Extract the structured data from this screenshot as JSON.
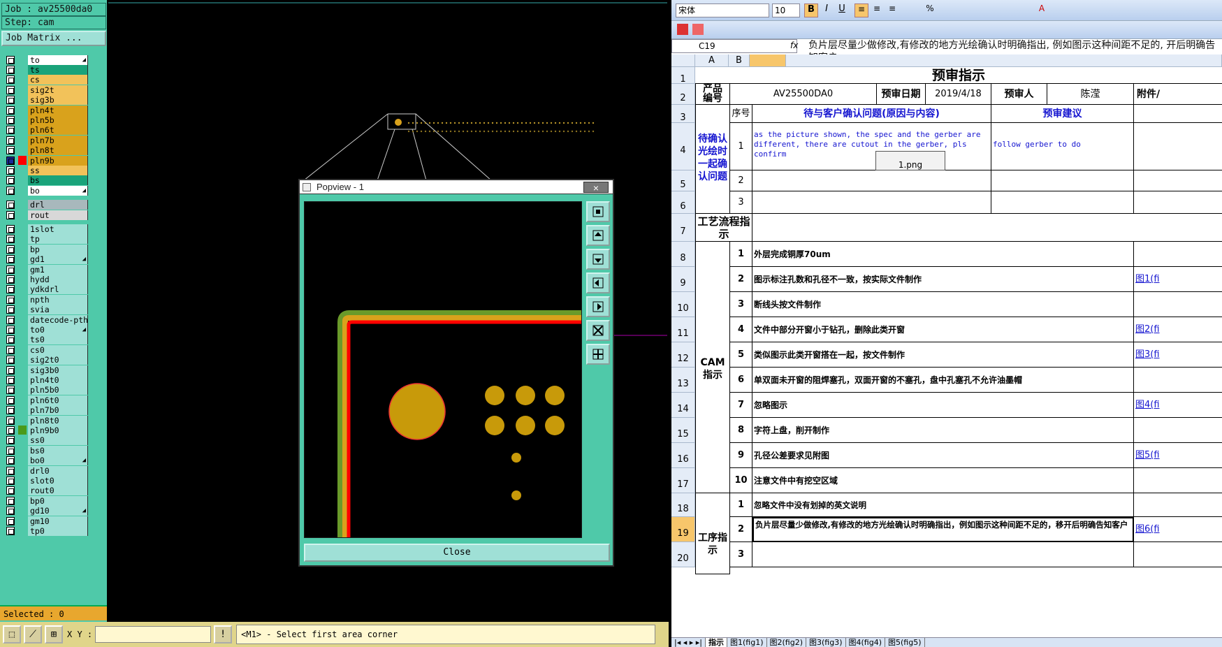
{
  "cam": {
    "job": "Job : av25500da0",
    "step": "Step: cam",
    "job_matrix": "Job Matrix ...",
    "selected": "Selected : 0",
    "xy_label": "X Y :",
    "message": "<M1> - Select first area corner"
  },
  "layers": [
    {
      "name": "to",
      "color": "#ffffff",
      "arrow": true
    },
    {
      "name": "ts",
      "color": "#1aa37a"
    },
    {
      "name": "cs",
      "color": "#f2c25a"
    },
    {
      "name": "sig2t",
      "color": "#f2c25a"
    },
    {
      "name": "sig3b",
      "color": "#f2c25a"
    },
    {
      "name": "pln4t",
      "color": "#d9a21c"
    },
    {
      "name": "pln5b",
      "color": "#d9a21c"
    },
    {
      "name": "pln6t",
      "color": "#d9a21c"
    },
    {
      "name": "pln7b",
      "color": "#d9a21c"
    },
    {
      "name": "pln8t",
      "color": "#d9a21c"
    },
    {
      "name": "pln9b",
      "color": "#d9a21c",
      "active": true
    },
    {
      "name": "ss",
      "color": "#f2c25a"
    },
    {
      "name": "bs",
      "color": "#1aa37a"
    },
    {
      "name": "bo",
      "color": "#ffffff",
      "arrow": true
    },
    {
      "name": "drl",
      "color": "#a8b8bc"
    },
    {
      "name": "rout",
      "color": "#d8d8d8"
    },
    {
      "name": "1slot",
      "color": "#9fe0d6"
    },
    {
      "name": "tp",
      "color": "#9fe0d6"
    },
    {
      "name": "bp",
      "color": "#9fe0d6"
    },
    {
      "name": "gd1",
      "color": "#9fe0d6",
      "arrow": true
    },
    {
      "name": "gm1",
      "color": "#9fe0d6"
    },
    {
      "name": "hydd",
      "color": "#9fe0d6"
    },
    {
      "name": "ydkdrl",
      "color": "#9fe0d6"
    },
    {
      "name": "npth",
      "color": "#9fe0d6"
    },
    {
      "name": "svia",
      "color": "#9fe0d6"
    },
    {
      "name": "datecode-pth",
      "color": "#9fe0d6"
    },
    {
      "name": "to0",
      "color": "#9fe0d6",
      "arrow": true
    },
    {
      "name": "ts0",
      "color": "#9fe0d6"
    },
    {
      "name": "cs0",
      "color": "#9fe0d6"
    },
    {
      "name": "sig2t0",
      "color": "#9fe0d6"
    },
    {
      "name": "sig3b0",
      "color": "#9fe0d6"
    },
    {
      "name": "pln4t0",
      "color": "#9fe0d6"
    },
    {
      "name": "pln5b0",
      "color": "#9fe0d6"
    },
    {
      "name": "pln6t0",
      "color": "#9fe0d6"
    },
    {
      "name": "pln7b0",
      "color": "#9fe0d6"
    },
    {
      "name": "pln8t0",
      "color": "#9fe0d6"
    },
    {
      "name": "pln9b0",
      "color": "#9fe0d6",
      "green": true
    },
    {
      "name": "ss0",
      "color": "#9fe0d6"
    },
    {
      "name": "bs0",
      "color": "#9fe0d6"
    },
    {
      "name": "bo0",
      "color": "#9fe0d6",
      "arrow": true
    },
    {
      "name": "drl0",
      "color": "#9fe0d6"
    },
    {
      "name": "slot0",
      "color": "#9fe0d6"
    },
    {
      "name": "rout0",
      "color": "#9fe0d6"
    },
    {
      "name": "bp0",
      "color": "#9fe0d6"
    },
    {
      "name": "gd10",
      "color": "#9fe0d6",
      "arrow": true
    },
    {
      "name": "gm10",
      "color": "#9fe0d6"
    },
    {
      "name": "tp0",
      "color": "#9fe0d6"
    }
  ],
  "popview": {
    "title": "Popview - 1",
    "close": "Close",
    "close_x": "×"
  },
  "excel": {
    "font": "宋体",
    "size": "10",
    "cell": "C19",
    "fx": "fx",
    "formula": "负片层尽量少做修改,有修改的地方光绘确认时明确指出, 例如图示这种间距不足的, 开后明确告知客户",
    "columns": [
      "A",
      "B"
    ],
    "title": "预审指示",
    "product_label": "产品\n编号",
    "product": "AV25500DA0",
    "date_label": "预审日期",
    "date": "2019/4/18",
    "reviewer_label": "预审人",
    "reviewer": "陈滢",
    "attach_label": "附件/",
    "seq_label": "序号",
    "issue_label": "待与客户确认问题(原因与内容)",
    "advice_label": "预审建议",
    "confirm_group": "待确认光绘时一起确认问题",
    "issue1": "as the picture shown, the spec and the gerber are different, there are cutout in the gerber, pls confirm",
    "advice1": "follow gerber to do",
    "img1": "1.png",
    "process_label": "工艺流程指示",
    "cam_group": "CAM指示",
    "proc_group": "工序指示",
    "cam_items": [
      {
        "n": "1",
        "t": "外层完成铜厚70um",
        "ref": ""
      },
      {
        "n": "2",
        "t": "图示标注孔数和孔径不一致，按实际文件制作",
        "ref": "图1(fi"
      },
      {
        "n": "3",
        "t": "断线头按文件制作",
        "ref": ""
      },
      {
        "n": "4",
        "t": "文件中部分开窗小于钻孔，删除此类开窗",
        "ref": "图2(fi"
      },
      {
        "n": "5",
        "t": "类似图示此类开窗搭在一起，按文件制作",
        "ref": "图3(fi"
      },
      {
        "n": "6",
        "t": "单双面未开窗的阻焊塞孔，双面开窗的不塞孔，盘中孔塞孔不允许油墨帽",
        "ref": ""
      },
      {
        "n": "7",
        "t": "忽略图示",
        "ref": "图4(fi"
      },
      {
        "n": "8",
        "t": "字符上盘，削开制作",
        "ref": ""
      },
      {
        "n": "9",
        "t": "孔径公差要求见附图",
        "ref": "图5(fi"
      },
      {
        "n": "10",
        "t": "注意文件中有挖空区域",
        "ref": ""
      }
    ],
    "proc_items": [
      {
        "n": "1",
        "t": "忽略文件中没有划掉的英文说明",
        "ref": ""
      },
      {
        "n": "2",
        "t": "负片层尽量少做修改,有修改的地方光绘确认时明确指出，例如图示这种间距不足的，移开后明确告知客户",
        "ref": "图6(fi"
      },
      {
        "n": "3",
        "t": "",
        "ref": ""
      }
    ],
    "row_numbers": [
      "1",
      "2",
      "3",
      "4",
      "5",
      "6",
      "7",
      "8",
      "9",
      "10",
      "11",
      "12",
      "13",
      "14",
      "15",
      "16",
      "17",
      "18",
      "19",
      "20"
    ],
    "tabs": [
      "指示",
      "图1(fig1)",
      "图2(fig2)",
      "图3(fig3)",
      "图4(fig4)",
      "图5(fig5)"
    ]
  }
}
